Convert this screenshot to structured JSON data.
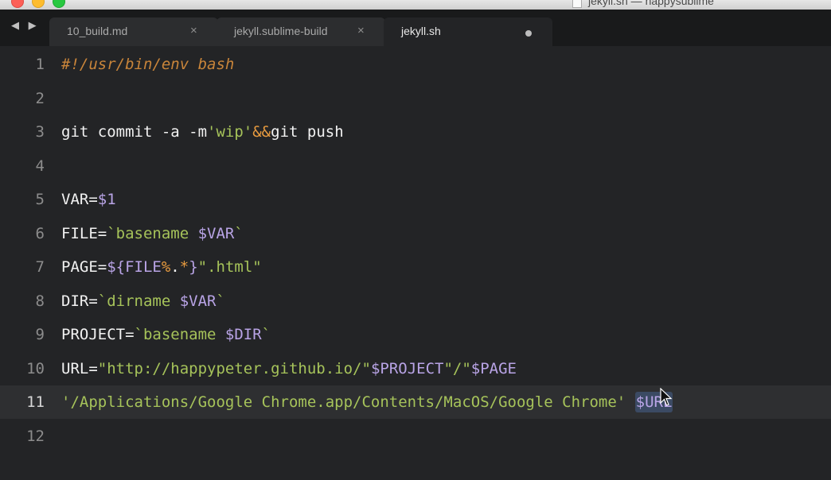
{
  "window": {
    "title": "jekyll.sh — happysublime"
  },
  "nav": {
    "back_glyph": "◀",
    "forward_glyph": "▶"
  },
  "tabs": [
    {
      "label": "10_build.md",
      "close": "×",
      "state": "inactive"
    },
    {
      "label": "jekyll.sublime-build",
      "close": "×",
      "state": "inactive"
    },
    {
      "label": "jekyll.sh",
      "dirty": true,
      "state": "active"
    }
  ],
  "editor": {
    "current_line": 11,
    "lines": [
      {
        "number": "1",
        "tokens": [
          {
            "t": "#!/usr/bin/env bash",
            "c": "comment"
          }
        ]
      },
      {
        "number": "2",
        "tokens": []
      },
      {
        "number": "3",
        "tokens": [
          {
            "t": "git commit -a -m",
            "c": "plain"
          },
          {
            "t": "'wip'",
            "c": "string"
          },
          {
            "t": "&&",
            "c": "op"
          },
          {
            "t": "git push",
            "c": "plain"
          }
        ]
      },
      {
        "number": "4",
        "tokens": []
      },
      {
        "number": "5",
        "tokens": [
          {
            "t": "VAR=",
            "c": "plain"
          },
          {
            "t": "$1",
            "c": "var"
          }
        ]
      },
      {
        "number": "6",
        "tokens": [
          {
            "t": "FILE=",
            "c": "plain"
          },
          {
            "t": "`basename ",
            "c": "string"
          },
          {
            "t": "$VAR",
            "c": "var"
          },
          {
            "t": "`",
            "c": "string"
          }
        ]
      },
      {
        "number": "7",
        "tokens": [
          {
            "t": "PAGE=",
            "c": "plain"
          },
          {
            "t": "${FILE",
            "c": "var"
          },
          {
            "t": "%",
            "c": "op"
          },
          {
            "t": ".",
            "c": "plain"
          },
          {
            "t": "*",
            "c": "op"
          },
          {
            "t": "}",
            "c": "var"
          },
          {
            "t": "\".html\"",
            "c": "string"
          }
        ]
      },
      {
        "number": "8",
        "tokens": [
          {
            "t": "DIR=",
            "c": "plain"
          },
          {
            "t": "`dirname ",
            "c": "string"
          },
          {
            "t": "$VAR",
            "c": "var"
          },
          {
            "t": "`",
            "c": "string"
          }
        ]
      },
      {
        "number": "9",
        "tokens": [
          {
            "t": "PROJECT=",
            "c": "plain"
          },
          {
            "t": "`basename ",
            "c": "string"
          },
          {
            "t": "$DIR",
            "c": "var"
          },
          {
            "t": "`",
            "c": "string"
          }
        ]
      },
      {
        "number": "10",
        "tokens": [
          {
            "t": "URL=",
            "c": "plain"
          },
          {
            "t": "\"http://happypeter.github.io/\"",
            "c": "string"
          },
          {
            "t": "$PROJECT",
            "c": "var"
          },
          {
            "t": "\"/\"",
            "c": "string"
          },
          {
            "t": "$PAGE",
            "c": "var"
          }
        ]
      },
      {
        "number": "11",
        "tokens": [
          {
            "t": "'/Applications/Google Chrome.app/Contents/MacOS/Google Chrome'",
            "c": "string"
          },
          {
            "t": " ",
            "c": "plain"
          },
          {
            "t": "$URL",
            "c": "highlight"
          }
        ]
      },
      {
        "number": "12",
        "tokens": []
      }
    ]
  },
  "colors": {
    "background": "#232426",
    "tabbar": "#191a1b",
    "comment": "#c9853a",
    "string": "#a6c35a",
    "variable": "#b9a4e6",
    "operator": "#e89b3f"
  }
}
